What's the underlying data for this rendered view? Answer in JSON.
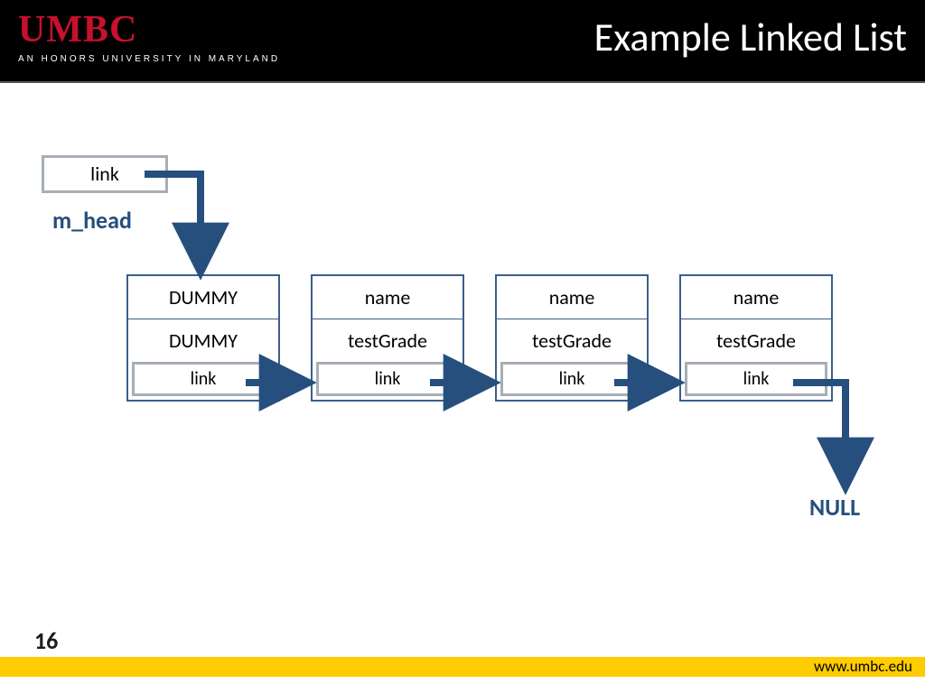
{
  "header": {
    "logo_main": "UMBC",
    "logo_tagline": "AN HONORS UNIVERSITY IN MARYLAND",
    "slide_title": "Example Linked List"
  },
  "footer": {
    "url": "www.umbc.edu",
    "page_number": "16"
  },
  "diagram": {
    "head_box_label": "link",
    "head_var_label": "m_head",
    "null_label": "NULL",
    "nodes": [
      {
        "field1": "DUMMY",
        "field2": "DUMMY",
        "link": "link"
      },
      {
        "field1": "name",
        "field2": "testGrade",
        "link": "link"
      },
      {
        "field1": "name",
        "field2": "testGrade",
        "link": "link"
      },
      {
        "field1": "name",
        "field2": "testGrade",
        "link": "link"
      }
    ]
  },
  "colors": {
    "arrow": "#264f7d",
    "node_border": "#3b5e8c",
    "link_border": "#a6aeb7",
    "accent_yellow": "#ffcc00",
    "brand_red": "#c8102e"
  }
}
